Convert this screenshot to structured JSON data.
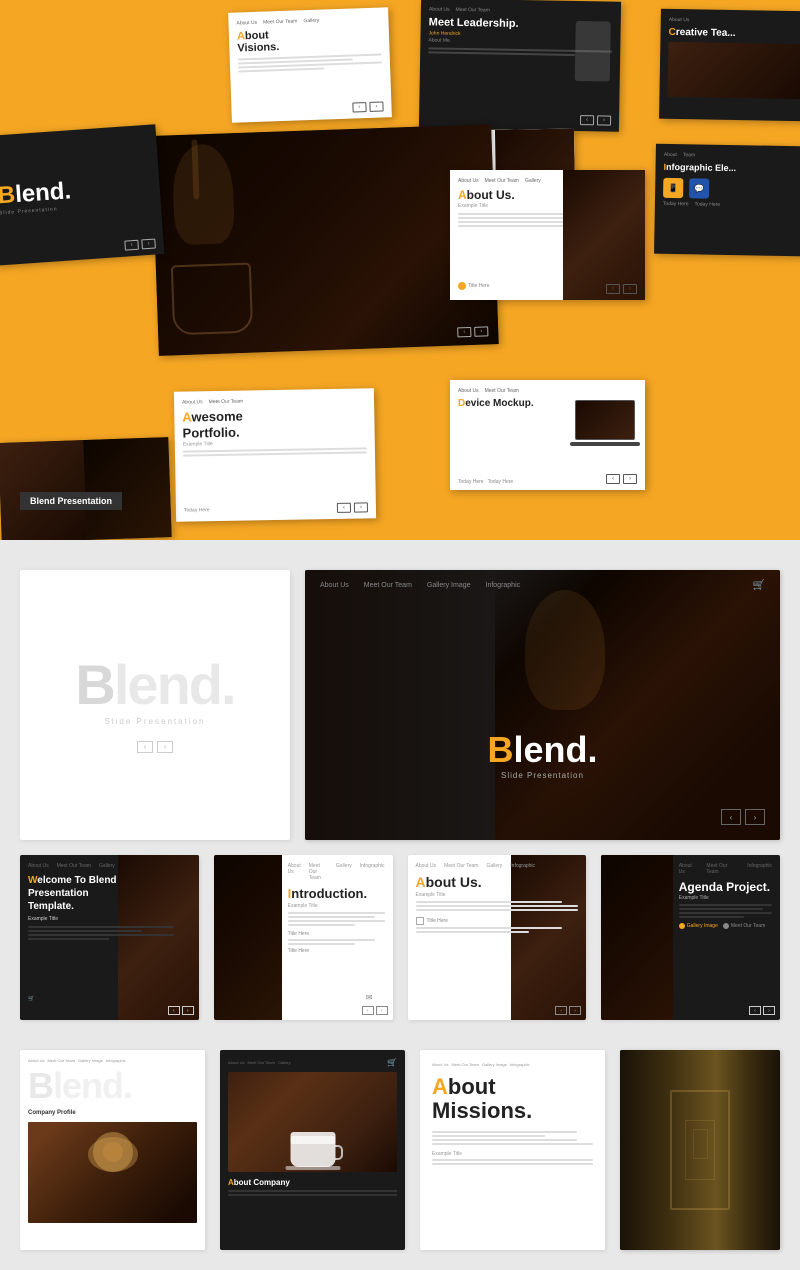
{
  "top_collage": {
    "brand": "Blend.",
    "brand_sub": "Slide Presentation",
    "label": "Blend Presentation",
    "cards": {
      "about_visions": "About Visions.",
      "meet_leadership": "Meet Leadership.",
      "creative_team": "Creative Tea...",
      "welcome": "Welcome To Blend Presentation Template.",
      "about_us_center": "About Us.",
      "device_mockup": "Device Mockup.",
      "infographic": "Infographic Ele...",
      "awesome_portfolio": "Awesome Portfolio.",
      "example_title": "Example Title",
      "title_here": "Title Here",
      "today_here": "Today Here",
      "john_hendrick": "John Hendrick",
      "about_me": "About Me"
    }
  },
  "middle_section": {
    "blend_large": "Blend.",
    "blend_brand": "Blend.",
    "slide_presentation": "Slide Presentation",
    "nav_items": [
      "About Us",
      "Meet Our Team",
      "Gallery Image",
      "Infographic"
    ],
    "cards": {
      "welcome_title": "Welcome To Blend Presentation Template.",
      "example_title": "Example Title",
      "introduction_title": "Introduction.",
      "about_us_title": "About Us.",
      "agenda_title": "Agenda Project.",
      "agenda_example": "Example Title"
    }
  },
  "bottom_section": {
    "company_profile": "Company Profile",
    "about_company": "About Company",
    "about_missions": "About Missions.",
    "orange_first_letter": "A"
  },
  "nav": {
    "about_us": "About Us",
    "meet_team": "Meet Our Team",
    "gallery": "Gallery Image",
    "infographic": "Infographic"
  },
  "icons": {
    "cart": "🛒",
    "arrow_left": "‹",
    "arrow_right": "›"
  }
}
